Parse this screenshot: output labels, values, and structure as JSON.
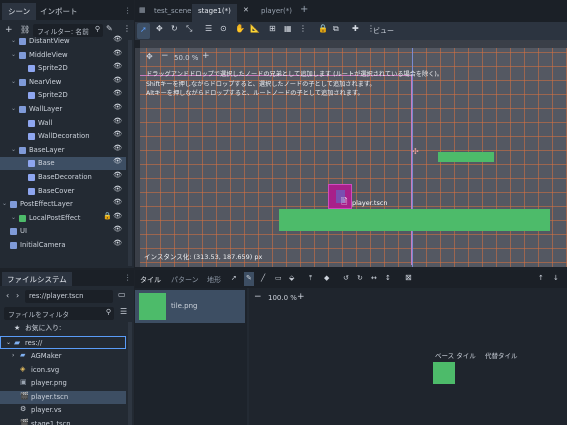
{
  "scene_dock": {
    "tabs": [
      "シーン",
      "インポート"
    ],
    "filter_placeholder": "フィルター: 名前",
    "tree": [
      {
        "label": "DistantView",
        "indent": 1
      },
      {
        "label": "MiddleView",
        "indent": 1
      },
      {
        "label": "Sprite2D",
        "indent": 2
      },
      {
        "label": "NearView",
        "indent": 1
      },
      {
        "label": "Sprite2D",
        "indent": 2
      },
      {
        "label": "WallLayer",
        "indent": 1
      },
      {
        "label": "Wall",
        "indent": 2
      },
      {
        "label": "WallDecoration",
        "indent": 2
      },
      {
        "label": "BaseLayer",
        "indent": 1
      },
      {
        "label": "Base",
        "indent": 2
      },
      {
        "label": "BaseDecoration",
        "indent": 2
      },
      {
        "label": "BaseCover",
        "indent": 2
      },
      {
        "label": "PostEffectLayer",
        "indent": 0
      },
      {
        "label": "LocalPostEffect",
        "indent": 1
      },
      {
        "label": "UI",
        "indent": 0
      },
      {
        "label": "InitialCamera",
        "indent": 0
      }
    ]
  },
  "fs_dock": {
    "title": "ファイルシステム",
    "path": "res://player.tscn",
    "filter_placeholder": "ファイルをフィルタ",
    "favorites": "お気に入り:",
    "root": "res://",
    "items": [
      "AGMaker",
      "icon.svg",
      "player.png",
      "player.tscn",
      "player.vs",
      "stage1.tscn"
    ]
  },
  "editor_tabs": [
    "test_scene",
    "stage1(*)",
    "player(*)"
  ],
  "toolbar": {
    "zoom": "50.0 %",
    "view_label": "ビュー"
  },
  "viewport": {
    "hint_lines": [
      "ドラッグアンドドロップで選択したノードの兄弟として追加します (ルートが選択されている場合を除く)。",
      "Shiftキーを押しながらドロップすると、選択したノードの子として追加されます。",
      "Altキーを押しながらドロップすると、ルートノードの子として追加されます。"
    ],
    "drop_label": "player.tscn",
    "status": "インスタンス化: (313.53, 187.659) px"
  },
  "tile_panel": {
    "tabs": [
      "タイル",
      "パターン",
      "地形"
    ],
    "tile_item": "tile.png",
    "zoom": "100.0 %",
    "base_tile_label": "ベース タイル",
    "alt_tile_label": "代替タイル"
  },
  "colors": {
    "green": "#4dbb6a",
    "selection": "#3d4e63",
    "accent": "#5a9cf8"
  }
}
